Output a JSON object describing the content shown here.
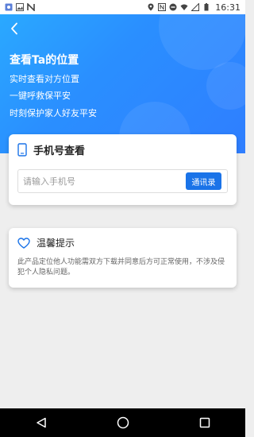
{
  "status_bar": {
    "time": "16:31",
    "left_icons": [
      "image-icon",
      "photo-icon",
      "n-notification-icon"
    ],
    "right_icons": [
      "location-icon",
      "nfc-icon",
      "dnd-icon",
      "wifi-icon",
      "signal-icon",
      "battery-icon"
    ]
  },
  "header": {
    "title": "查看Ta的位置",
    "lines": [
      "实时查看对方位置",
      "一键呼救保平安",
      "时刻保护家人好友平安"
    ],
    "gradient_from": "#2aa9ff",
    "gradient_to": "#2f7eff"
  },
  "phone_card": {
    "title": "手机号查看",
    "input_placeholder": "请输入手机号",
    "input_value": "",
    "contacts_button": "通讯录",
    "accent": "#1a73e8"
  },
  "tip_card": {
    "title": "温馨提示",
    "text": "此产品定位他人功能需双方下载并同意后方可正常使用，不涉及侵犯个人隐私问题。"
  },
  "nav_bar": {
    "buttons": [
      "back-triangle-icon",
      "home-circle-icon",
      "recents-square-icon"
    ]
  }
}
